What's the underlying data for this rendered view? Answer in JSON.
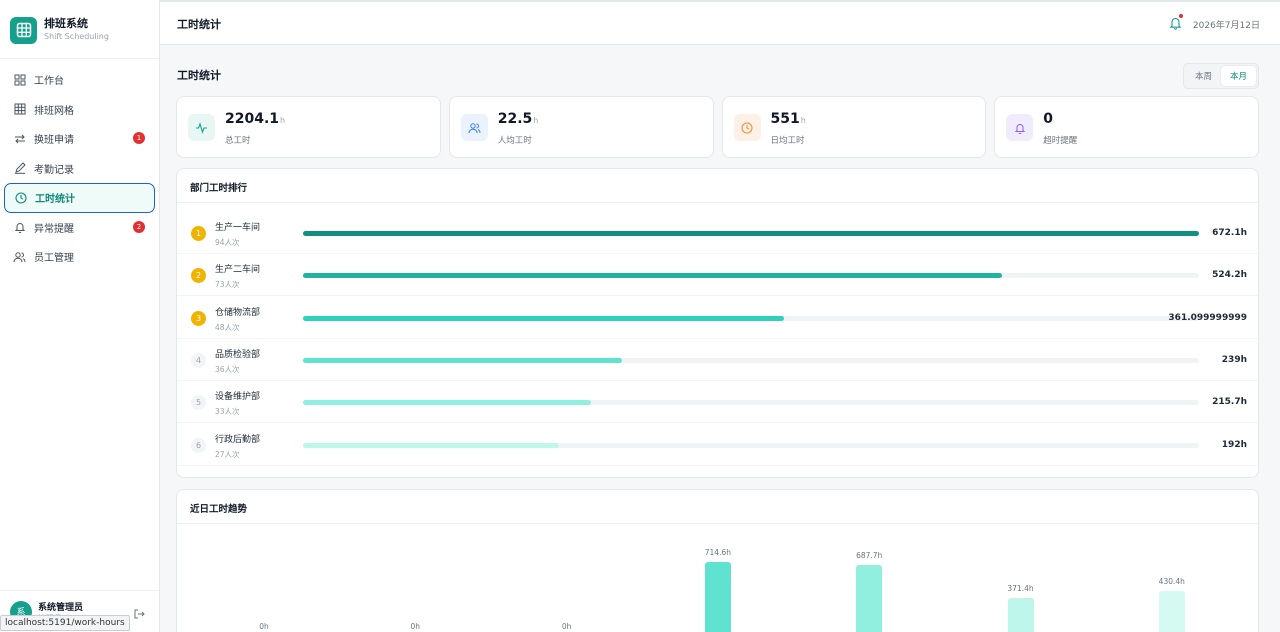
{
  "brand": {
    "title": "排班系统",
    "subtitle": "Shift Scheduling"
  },
  "sidebar": {
    "items": [
      {
        "label": "工作台",
        "icon": "grid-icon",
        "badge": ""
      },
      {
        "label": "排班网格",
        "icon": "table-icon",
        "badge": ""
      },
      {
        "label": "换班申请",
        "icon": "swap-icon",
        "badge": "1"
      },
      {
        "label": "考勤记录",
        "icon": "pencil-icon",
        "badge": ""
      },
      {
        "label": "工时统计",
        "icon": "clock-icon",
        "badge": "",
        "active": true
      },
      {
        "label": "异常提醒",
        "icon": "bell-icon",
        "badge": "2"
      },
      {
        "label": "员工管理",
        "icon": "users-icon",
        "badge": ""
      }
    ]
  },
  "user": {
    "avatar": "系",
    "name": "系统管理员",
    "role": "管理员"
  },
  "status_url": "localhost:5191/work-hours",
  "topbar": {
    "title": "工时统计",
    "date": "2026年7月12日"
  },
  "main": {
    "title": "工时统计",
    "range": {
      "week": "本周",
      "month": "本月",
      "selected": "本月"
    }
  },
  "stats": [
    {
      "value": "2204.1",
      "unit": "h",
      "label": "总工时",
      "icon": "activity-icon",
      "color": "#14a08c",
      "bg": "#e8f7f4"
    },
    {
      "value": "22.5",
      "unit": "h",
      "label": "人均工时",
      "icon": "users-icon",
      "color": "#3b82f6",
      "bg": "#eaf2fe"
    },
    {
      "value": "551",
      "unit": "h",
      "label": "日均工时",
      "icon": "clock-icon",
      "color": "#f08c3c",
      "bg": "#fdf1e7"
    },
    {
      "value": "0",
      "unit": "",
      "label": "超时提醒",
      "icon": "bell-icon",
      "color": "#8b5cf6",
      "bg": "#f1ecfd"
    }
  ],
  "ranking": {
    "title": "部门工时排行",
    "rows": [
      {
        "rank": "1",
        "name": "生产一车间",
        "count": "94人次",
        "hours": 672.1,
        "value_label": "672.1h",
        "color": "#138f80"
      },
      {
        "rank": "2",
        "name": "生产二车间",
        "count": "73人次",
        "hours": 524.2,
        "value_label": "524.2h",
        "color": "#1fb3a0"
      },
      {
        "rank": "3",
        "name": "仓储物流部",
        "count": "48人次",
        "hours": 361.1,
        "value_label": "361.099999999",
        "color": "#2fd0bc"
      },
      {
        "rank": "4",
        "name": "品质检验部",
        "count": "36人次",
        "hours": 239,
        "value_label": "239h",
        "color": "#5fe2cf"
      },
      {
        "rank": "5",
        "name": "设备维护部",
        "count": "33人次",
        "hours": 215.7,
        "value_label": "215.7h",
        "color": "#90efdf"
      },
      {
        "rank": "6",
        "name": "行政后勤部",
        "count": "27人次",
        "hours": 192,
        "value_label": "192h",
        "color": "#bff6ec"
      }
    ],
    "rank_colors": {
      "top": "#f0b400",
      "other_bg": "#f3f4f6",
      "other_fg": "#9ca3af"
    }
  },
  "trend": {
    "title": "近日工时趋势",
    "chart_data": {
      "type": "bar",
      "values": [
        0,
        0,
        0,
        714.6,
        687.7,
        371.4,
        430.4
      ],
      "labels": [
        "0h",
        "0h",
        "0h",
        "714.6h",
        "687.7h",
        "371.4h",
        "430.4h"
      ],
      "colors": [
        "#5fe2cf",
        "#5fe2cf",
        "#5fe2cf",
        "#5fe2cf",
        "#90efdf",
        "#bff6ec",
        "#d4faf2"
      ]
    }
  }
}
